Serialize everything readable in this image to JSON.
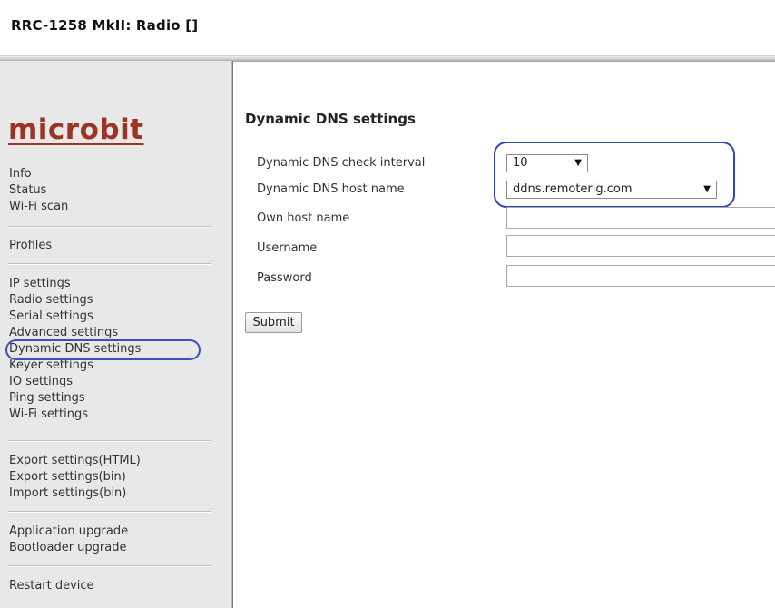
{
  "header": {
    "title": "RRC-1258 MkII: Radio []"
  },
  "logo": {
    "text": "microbit",
    "color": "#9b3424"
  },
  "sidebar": {
    "groups": [
      [
        "Info",
        "Status",
        "Wi-Fi scan"
      ],
      [
        "Profiles"
      ],
      [
        "IP settings",
        "Radio settings",
        "Serial settings",
        "Advanced settings",
        "Dynamic DNS settings",
        "Keyer settings",
        "IO settings",
        "Ping settings",
        "Wi-Fi settings"
      ],
      [
        "Export settings(HTML)",
        "Export settings(bin)",
        "Import settings(bin)"
      ],
      [
        "Application upgrade",
        "Bootloader upgrade"
      ],
      [
        "Restart device"
      ]
    ],
    "active": "Dynamic DNS settings"
  },
  "main": {
    "section_title": "Dynamic DNS settings",
    "fields": {
      "check_interval": {
        "label": "Dynamic DNS check interval",
        "value": "10"
      },
      "host_name": {
        "label": "Dynamic DNS host name",
        "value": "ddns.remoterig.com"
      },
      "own_host_name": {
        "label": "Own host name",
        "value": ""
      },
      "username": {
        "label": "Username",
        "value": ""
      },
      "password": {
        "label": "Password",
        "value": ""
      }
    },
    "submit_label": "Submit"
  },
  "colors": {
    "annotation_ring": "#2e47b8",
    "sidebar_bg": "#e8e8e8"
  },
  "icons": {
    "dropdown": "triangle-down-icon"
  }
}
